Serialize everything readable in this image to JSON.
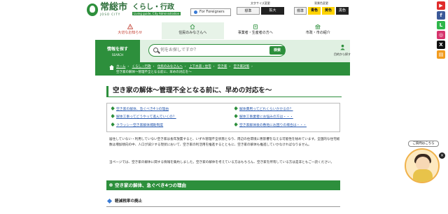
{
  "header": {
    "logo_city": "常総市",
    "logo_city_en": "JOSO CITY",
    "logo_section": "くらし・行政",
    "logo_section_sub": "Living guide, City Administration",
    "foreign_label": "For Foreigners",
    "font_size": {
      "label": "文字サイズ変更",
      "standard": "標準",
      "large": "拡大"
    },
    "color_scheme": {
      "label": "背景色変更",
      "standard": "標準",
      "blue": "青色",
      "yellow": "黄色",
      "black": "黒色"
    }
  },
  "nav": [
    {
      "label": "大切なお知らせ",
      "icon": "warning-icon",
      "state": "warn"
    },
    {
      "label": "住民のみなさんへ",
      "icon": "house-icon",
      "state": "active"
    },
    {
      "label": "事業者・生産者の方へ",
      "icon": "building-icon",
      "state": ""
    },
    {
      "label": "市政・市の紹介",
      "icon": "city-hall-icon",
      "state": ""
    }
  ],
  "search": {
    "section_label": "情報を探す",
    "section_label_en": "SEARCH",
    "placeholder": "何をお探しですか？",
    "button": "検索",
    "purpose_label": "目的から探す"
  },
  "breadcrumb": [
    "ホーム",
    "くらし・行政",
    "住民のみなさんへ",
    "上下水道・住宅",
    "空き家",
    "空き家対策",
    "空き家の解体〜管理不全となる前に、早めの対応を〜"
  ],
  "page": {
    "title": "空き家の解体〜管理不全となる前に、早めの対応を〜",
    "toc": [
      "空き家の解体、急ぐべき4つの理由",
      "解体費用ってどれくらいかかるの？",
      "解体工事ってどうやって進んでいくの？",
      "解体工事業者にお悩みの方は・・・",
      "クラッシー空き家解体補助制度",
      "空き家解体後の敷地にお困りの場合は・・・"
    ],
    "para1": "居住していない・利用していない空き家は長年放置すると、いずれ管理不全状態となり、周辺の住環境に悪影響を与える可能性を秘めています。全国的な住宅総数は増加傾向の中、人口が減少する現状において、空き家の利活用を推進するとともに、空き家の解体も推進していかなければなりません。",
    "para2": "当ページでは、空き家の解体に関する情報を集約しました。空き家の解体を考えている方はもちろん、空き家を所有している方は是非ともご一読ください。",
    "h2": "空き家の解体、急ぐべき4つの理由",
    "h3": "軽減税率の廃止"
  },
  "sns": [
    {
      "name": "youtube-icon",
      "color": "#e02b2b",
      "glyph": "▶"
    },
    {
      "name": "facebook-icon",
      "color": "#3b5998",
      "glyph": "f"
    },
    {
      "name": "line-icon",
      "color": "#2fb64a",
      "glyph": "L"
    },
    {
      "name": "instagram-icon",
      "color": "#d6336c",
      "glyph": "◎"
    },
    {
      "name": "x-icon",
      "color": "#111111",
      "glyph": "X"
    },
    {
      "name": "book-icon",
      "color": "#f29b1d",
      "glyph": "▤"
    }
  ],
  "concierge": {
    "label": "ご質問はこちら"
  }
}
